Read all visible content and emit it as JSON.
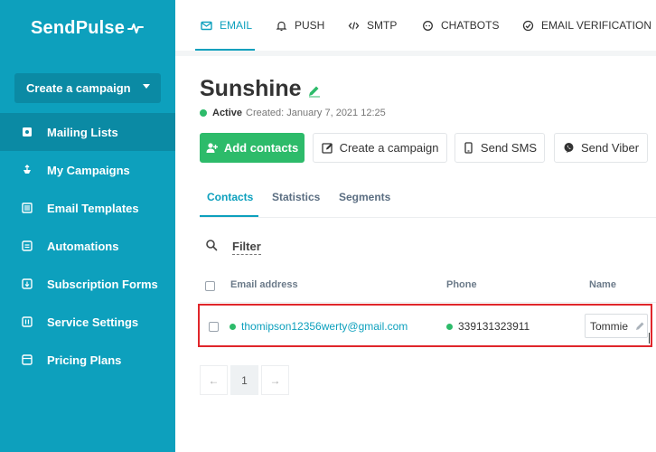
{
  "app": {
    "logo": "SendPulse"
  },
  "sidebar": {
    "create_label": "Create a campaign",
    "items": [
      {
        "label": "Mailing Lists",
        "icon": "mailing-list-icon",
        "active": true
      },
      {
        "label": "My Campaigns",
        "icon": "campaigns-icon",
        "active": false
      },
      {
        "label": "Email Templates",
        "icon": "templates-icon",
        "active": false
      },
      {
        "label": "Automations",
        "icon": "automations-icon",
        "active": false
      },
      {
        "label": "Subscription Forms",
        "icon": "forms-icon",
        "active": false
      },
      {
        "label": "Service Settings",
        "icon": "settings-icon",
        "active": false
      },
      {
        "label": "Pricing Plans",
        "icon": "pricing-icon",
        "active": false
      }
    ]
  },
  "topnav": {
    "items": [
      {
        "label": "EMAIL",
        "icon": "envelope-icon",
        "active": true
      },
      {
        "label": "PUSH",
        "icon": "bell-icon",
        "active": false
      },
      {
        "label": "SMTP",
        "icon": "code-icon",
        "active": false
      },
      {
        "label": "CHATBOTS",
        "icon": "chat-icon",
        "active": false
      },
      {
        "label": "EMAIL VERIFICATION",
        "icon": "check-circle-icon",
        "active": false
      }
    ]
  },
  "header": {
    "title": "Sunshine",
    "status": "Active",
    "created": "Created: January 7, 2021 12:25"
  },
  "actions": {
    "add_contacts": "Add contacts",
    "create_campaign": "Create a campaign",
    "send_sms": "Send SMS",
    "send_viber": "Send Viber"
  },
  "tabs": [
    {
      "label": "Contacts",
      "active": true
    },
    {
      "label": "Statistics",
      "active": false
    },
    {
      "label": "Segments",
      "active": false
    }
  ],
  "filter": {
    "label": "Filter"
  },
  "table": {
    "columns": [
      "Email address",
      "Phone",
      "Name"
    ],
    "rows": [
      {
        "email": "thomipson12356werty@gmail.com",
        "phone": "339131323911",
        "name": "Tommie"
      }
    ]
  },
  "pagination": {
    "prev": "←",
    "current": "1",
    "next": "→"
  },
  "colors": {
    "brand": "#0da0bd",
    "sidebar_active": "#0b8aa4",
    "success": "#2dbb6a",
    "highlight": "#e0262b"
  }
}
